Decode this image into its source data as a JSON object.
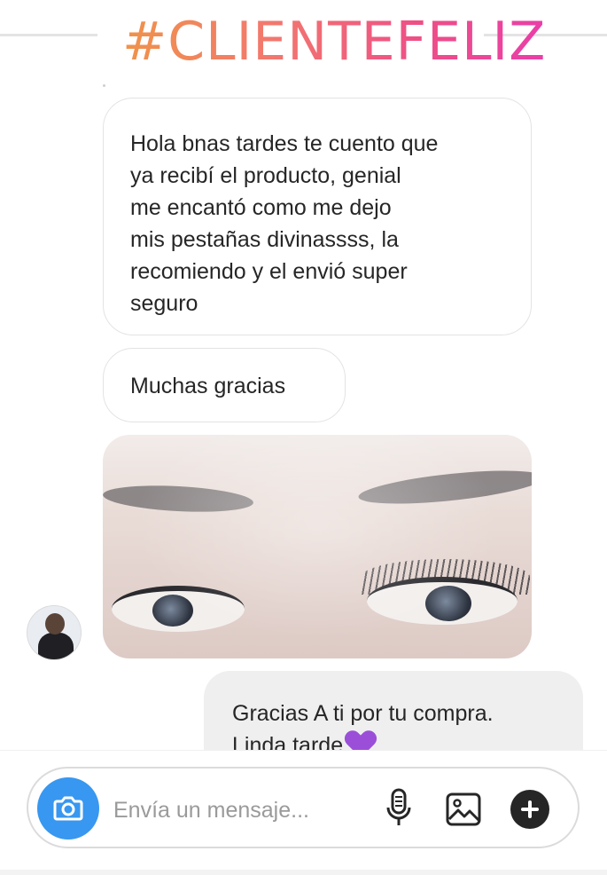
{
  "banner": {
    "hashtag": "#CLIENTEFELIZ"
  },
  "chat": {
    "messages": [
      {
        "from": "customer",
        "text": "Hola bnas tardes te cuento que\nya recibí el producto, genial\nme encantó como me dejo\nmis pestañas divinassss, la\nrecomiendo y el envió super\nseguro"
      },
      {
        "from": "customer",
        "text": "Muchas gracias"
      },
      {
        "from": "customer",
        "type": "photo"
      },
      {
        "from": "me",
        "line1": "Gracias A ti por tu compra.",
        "line2": "Linda tarde"
      }
    ],
    "heart_emoji": "purple-heart"
  },
  "composer": {
    "placeholder": "Envía un mensaje...",
    "icons": [
      "camera-icon",
      "microphone-icon",
      "gallery-icon",
      "plus-icon"
    ]
  },
  "colors": {
    "hashtag_gradient": [
      "#f0934a",
      "#ee4f86",
      "#e93ea9"
    ],
    "camera_button": "#3897f0",
    "outgoing_bubble": "#efefef",
    "heart": "#9b4fd8"
  }
}
